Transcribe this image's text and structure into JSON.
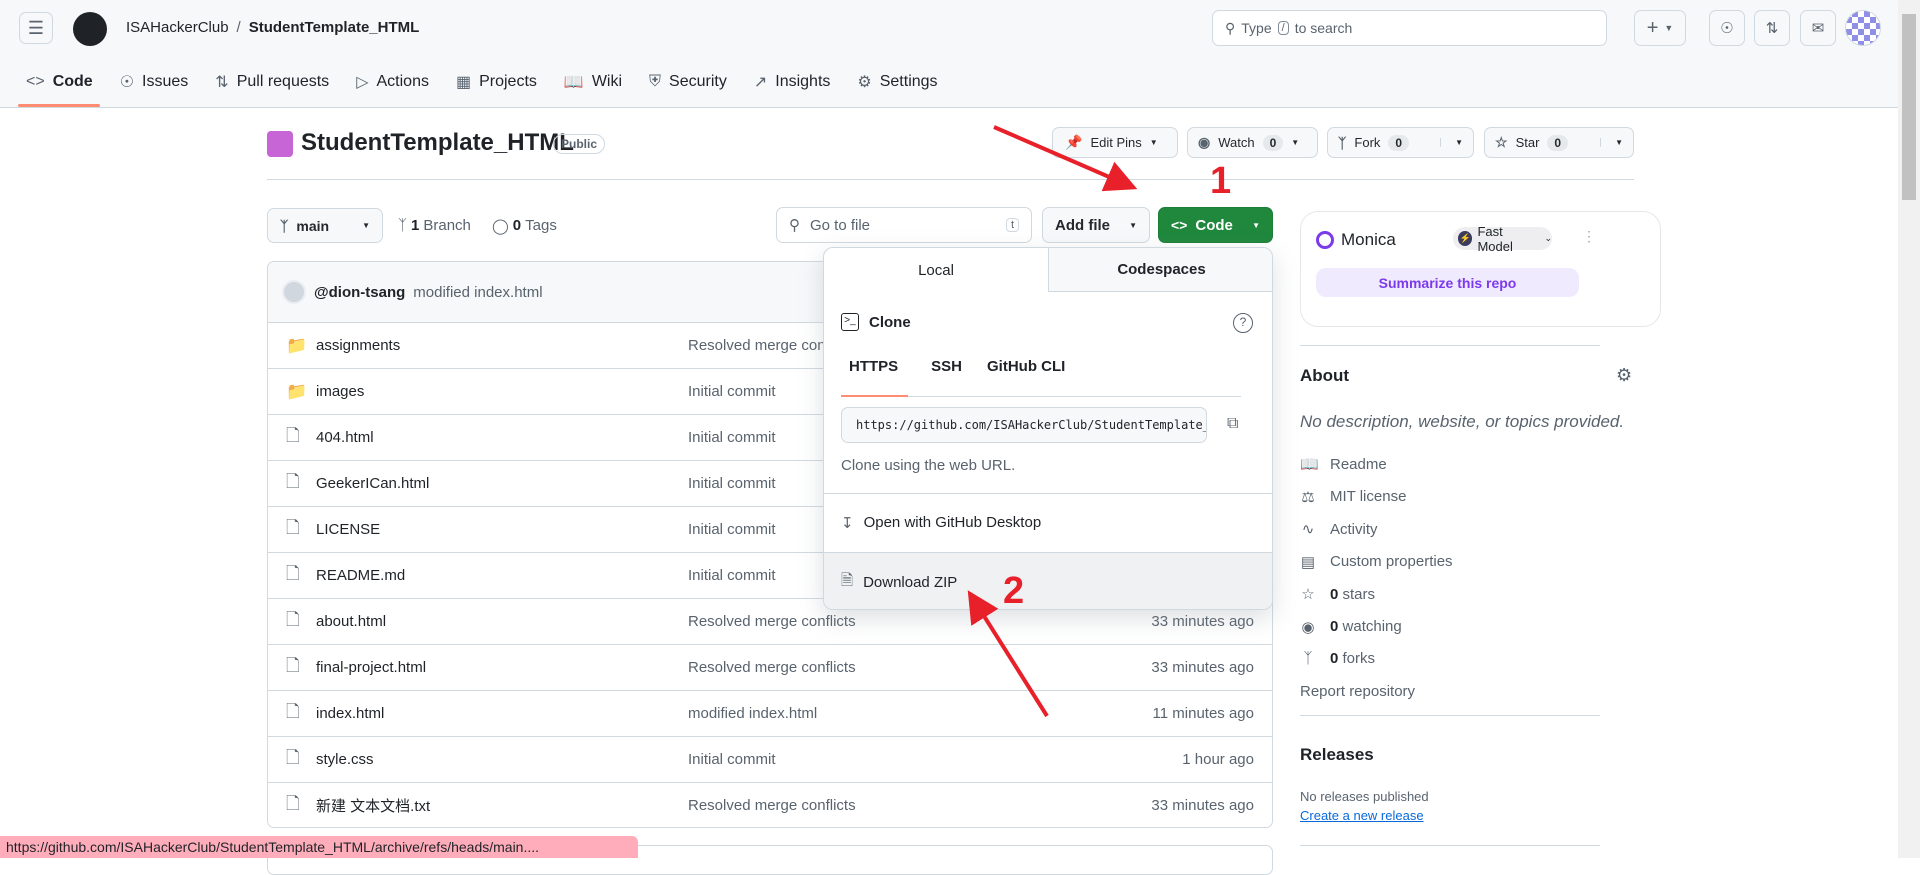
{
  "header": {
    "owner": "ISAHackerClub",
    "separator": "/",
    "repo": "StudentTemplate_HTML",
    "search_placeholder_pre": "Type",
    "search_key": "/",
    "search_placeholder_post": "to search",
    "plus_label": "+"
  },
  "nav": {
    "tabs": [
      {
        "label": "Code",
        "icon": "code-icon",
        "active": true
      },
      {
        "label": "Issues",
        "icon": "issue-icon"
      },
      {
        "label": "Pull requests",
        "icon": "pull-request-icon"
      },
      {
        "label": "Actions",
        "icon": "play-icon"
      },
      {
        "label": "Projects",
        "icon": "table-icon"
      },
      {
        "label": "Wiki",
        "icon": "book-icon"
      },
      {
        "label": "Security",
        "icon": "shield-icon"
      },
      {
        "label": "Insights",
        "icon": "graph-icon"
      },
      {
        "label": "Settings",
        "icon": "gear-icon"
      }
    ]
  },
  "repo": {
    "title": "StudentTemplate_HTML",
    "visibility": "Public",
    "edit_pins": "Edit Pins",
    "watch": "Watch",
    "watch_count": "0",
    "fork": "Fork",
    "fork_count": "0",
    "star": "Star",
    "star_count": "0"
  },
  "toolbar": {
    "branch": "main",
    "branch_count": "1",
    "branch_label": "Branch",
    "tag_count": "0",
    "tag_label": "Tags",
    "goto_placeholder": "Go to file",
    "goto_key": "t",
    "add_file": "Add file",
    "code": "Code"
  },
  "commit": {
    "author": "@dion-tsang",
    "message": "modified index.html"
  },
  "files": [
    {
      "name": "assignments",
      "type": "folder",
      "message": "Resolved merge conflicts",
      "time": ""
    },
    {
      "name": "images",
      "type": "folder",
      "message": "Initial commit",
      "time": ""
    },
    {
      "name": "404.html",
      "type": "file",
      "message": "Initial commit",
      "time": ""
    },
    {
      "name": "GeekerICan.html",
      "type": "file",
      "message": "Initial commit",
      "time": ""
    },
    {
      "name": "LICENSE",
      "type": "file",
      "message": "Initial commit",
      "time": ""
    },
    {
      "name": "README.md",
      "type": "file",
      "message": "Initial commit",
      "time": ""
    },
    {
      "name": "about.html",
      "type": "file",
      "message": "Resolved merge conflicts",
      "time": "33 minutes ago"
    },
    {
      "name": "final-project.html",
      "type": "file",
      "message": "Resolved merge conflicts",
      "time": "33 minutes ago"
    },
    {
      "name": "index.html",
      "type": "file",
      "message": "modified index.html",
      "time": "11 minutes ago"
    },
    {
      "name": "style.css",
      "type": "file",
      "message": "Initial commit",
      "time": "1 hour ago"
    },
    {
      "name": "新建 文本文档.txt",
      "type": "file",
      "message": "Resolved merge conflicts",
      "time": "33 minutes ago"
    }
  ],
  "dropdown": {
    "tabs": [
      "Local",
      "Codespaces"
    ],
    "clone_title": "Clone",
    "protocols": [
      "HTTPS",
      "SSH",
      "GitHub CLI"
    ],
    "url": "https://github.com/ISAHackerClub/StudentTemplate_HTML.git",
    "hint": "Clone using the web URL.",
    "open_desktop": "Open with GitHub Desktop",
    "download_zip": "Download ZIP"
  },
  "monica": {
    "name": "Monica",
    "model": "Fast Model",
    "summarize": "Summarize this repo"
  },
  "about": {
    "title": "About",
    "description": "No description, website, or topics provided.",
    "items": [
      {
        "icon": "book-icon",
        "label": "Readme"
      },
      {
        "icon": "law-icon",
        "label": "MIT license"
      },
      {
        "icon": "pulse-icon",
        "label": "Activity"
      },
      {
        "icon": "note-icon",
        "label": "Custom properties"
      },
      {
        "icon": "star-icon",
        "count": "0",
        "label": "stars"
      },
      {
        "icon": "eye-icon",
        "count": "0",
        "label": "watching"
      },
      {
        "icon": "fork-icon",
        "count": "0",
        "label": "forks"
      }
    ],
    "report": "Report repository"
  },
  "releases": {
    "title": "Releases",
    "none": "No releases published",
    "create": "Create a new release"
  },
  "status_url": "https://github.com/ISAHackerClub/StudentTemplate_HTML/archive/refs/heads/main....",
  "annotations": {
    "step1": "1",
    "step2": "2",
    "color": "#e8202a"
  },
  "colors": {
    "accent": "#fd8c73",
    "code_green": "#1f883d",
    "link": "#0969da",
    "monica_purple": "#7c3aed"
  }
}
